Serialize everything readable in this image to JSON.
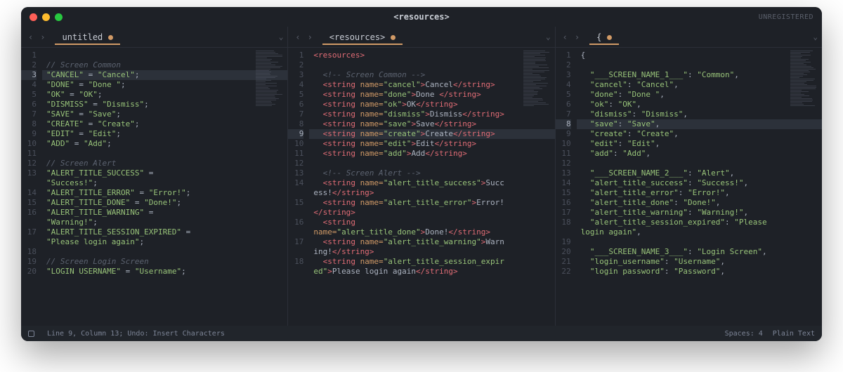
{
  "window": {
    "title": "<resources>",
    "unregistered": "UNREGISTERED"
  },
  "status": {
    "left": "Line 9, Column 13; Undo: Insert Characters",
    "spaces": "Spaces: 4",
    "syntax": "Plain Text"
  },
  "panes": [
    {
      "tab": "untitled",
      "current_line": 3,
      "lines": [
        {
          "n": 1,
          "h": ""
        },
        {
          "n": 2,
          "h": "<span class='c'>// Screen Common</span>"
        },
        {
          "n": 3,
          "h": "<span class='s'>\"CANCEL\"</span> = <span class='s'>\"Cancel\"</span>;"
        },
        {
          "n": 4,
          "h": "<span class='s'>\"DONE\"</span> = <span class='s'>\"Done \"</span>;"
        },
        {
          "n": 5,
          "h": "<span class='s'>\"OK\"</span> = <span class='s'>\"OK\"</span>;"
        },
        {
          "n": 6,
          "h": "<span class='s'>\"DISMISS\"</span> = <span class='s'>\"Dismiss\"</span>;"
        },
        {
          "n": 7,
          "h": "<span class='s'>\"SAVE\"</span> = <span class='s'>\"Save\"</span>;"
        },
        {
          "n": 8,
          "h": "<span class='s'>\"CREATE\"</span> = <span class='s'>\"Create\"</span>;"
        },
        {
          "n": 9,
          "h": "<span class='s'>\"EDIT\"</span> = <span class='s'>\"Edit\"</span>;"
        },
        {
          "n": 10,
          "h": "<span class='s'>\"ADD\"</span> = <span class='s'>\"Add\"</span>;"
        },
        {
          "n": 11,
          "h": ""
        },
        {
          "n": 12,
          "h": "<span class='c'>// Screen Alert</span>"
        },
        {
          "n": 13,
          "h": "<span class='s'>\"ALERT_TITLE_SUCCESS\"</span> = "
        },
        {
          "n": null,
          "h": "<span class='s'>\"Success!\"</span>;"
        },
        {
          "n": 14,
          "h": "<span class='s'>\"ALERT_TITLE_ERROR\"</span> = <span class='s'>\"Error!\"</span>;"
        },
        {
          "n": 15,
          "h": "<span class='s'>\"ALERT_TITLE_DONE\"</span> = <span class='s'>\"Done!\"</span>;"
        },
        {
          "n": 16,
          "h": "<span class='s'>\"ALERT_TITLE_WARNING\"</span> = "
        },
        {
          "n": null,
          "h": "<span class='s'>\"Warning!\"</span>;"
        },
        {
          "n": 17,
          "h": "<span class='s'>\"ALERT_TITLE_SESSION_EXPIRED\"</span> = "
        },
        {
          "n": null,
          "h": "<span class='s'>\"Please login again\"</span>;"
        },
        {
          "n": 18,
          "h": ""
        },
        {
          "n": 19,
          "h": "<span class='c'>// Screen Login Screen</span>"
        },
        {
          "n": 20,
          "h": "<span class='s'>\"LOGIN USERNAME\"</span> = <span class='s'>\"Username\"</span>;"
        }
      ]
    },
    {
      "tab": "<resources>",
      "current_line": 9,
      "lines": [
        {
          "n": 1,
          "h": "<span class='t'>&lt;resources&gt;</span>"
        },
        {
          "n": 2,
          "h": ""
        },
        {
          "n": 3,
          "h": "  <span class='c'>&lt;!-- Screen Common --&gt;</span>"
        },
        {
          "n": 4,
          "h": "  <span class='t'>&lt;string</span> <span class='a'>name=</span><span class='s'>\"cancel\"</span><span class='t'>&gt;</span>Cancel<span class='t'>&lt;/string&gt;</span>"
        },
        {
          "n": 5,
          "h": "  <span class='t'>&lt;string</span> <span class='a'>name=</span><span class='s'>\"done\"</span><span class='t'>&gt;</span>Done <span class='t'>&lt;/string&gt;</span>"
        },
        {
          "n": 6,
          "h": "  <span class='t'>&lt;string</span> <span class='a'>name=</span><span class='s'>\"ok\"</span><span class='t'>&gt;</span>OK<span class='t'>&lt;/string&gt;</span>"
        },
        {
          "n": 7,
          "h": "  <span class='t'>&lt;string</span> <span class='a'>name=</span><span class='s'>\"dismiss\"</span><span class='t'>&gt;</span>Dismiss<span class='t'>&lt;/string&gt;</span>"
        },
        {
          "n": 8,
          "h": "  <span class='t'>&lt;string</span> <span class='a'>name=</span><span class='s'>\"save\"</span><span class='t'>&gt;</span>Save<span class='t'>&lt;/string&gt;</span>"
        },
        {
          "n": 9,
          "h": "  <span class='t'>&lt;string</span> <span class='a'>name=</span><span class='s'>\"create\"</span><span class='t'>&gt;</span>Create<span class='t'>&lt;/string&gt;</span>"
        },
        {
          "n": 10,
          "h": "  <span class='t'>&lt;string</span> <span class='a'>name=</span><span class='s'>\"edit\"</span><span class='t'>&gt;</span>Edit<span class='t'>&lt;/string&gt;</span>"
        },
        {
          "n": 11,
          "h": "  <span class='t'>&lt;string</span> <span class='a'>name=</span><span class='s'>\"add\"</span><span class='t'>&gt;</span>Add<span class='t'>&lt;/string&gt;</span>"
        },
        {
          "n": 12,
          "h": ""
        },
        {
          "n": 13,
          "h": "  <span class='c'>&lt;!-- Screen Alert --&gt;</span>"
        },
        {
          "n": 14,
          "h": "  <span class='t'>&lt;string</span> <span class='a'>name=</span><span class='s'>\"alert_title_success\"</span><span class='t'>&gt;</span>Succ"
        },
        {
          "n": null,
          "h": "ess!<span class='t'>&lt;/string&gt;</span>"
        },
        {
          "n": 15,
          "h": "  <span class='t'>&lt;string</span> <span class='a'>name=</span><span class='s'>\"alert_title_error\"</span><span class='t'>&gt;</span>Error!"
        },
        {
          "n": null,
          "h": "<span class='t'>&lt;/string&gt;</span>"
        },
        {
          "n": 16,
          "h": "  <span class='t'>&lt;string</span> "
        },
        {
          "n": null,
          "h": "<span class='a'>name=</span><span class='s'>\"alert_title_done\"</span><span class='t'>&gt;</span>Done!<span class='t'>&lt;/string&gt;</span>"
        },
        {
          "n": 17,
          "h": "  <span class='t'>&lt;string</span> <span class='a'>name=</span><span class='s'>\"alert_title_warning\"</span><span class='t'>&gt;</span>Warn"
        },
        {
          "n": null,
          "h": "ing!<span class='t'>&lt;/string&gt;</span>"
        },
        {
          "n": 18,
          "h": "  <span class='t'>&lt;string</span> <span class='a'>name=</span><span class='s'>\"alert_title_session_expir</span>"
        },
        {
          "n": null,
          "h": "<span class='s'>ed\"</span><span class='t'>&gt;</span>Please login again<span class='t'>&lt;/string&gt;</span>"
        }
      ]
    },
    {
      "tab": "{",
      "current_line": 8,
      "lines": [
        {
          "n": 1,
          "h": "<span class='p'>{</span>"
        },
        {
          "n": 2,
          "h": ""
        },
        {
          "n": 3,
          "h": "  <span class='s'>\"___SCREEN_NAME_1___\"</span>: <span class='s'>\"Common\"</span>,"
        },
        {
          "n": 4,
          "h": "  <span class='s'>\"cancel\"</span>: <span class='s'>\"Cancel\"</span>,"
        },
        {
          "n": 5,
          "h": "  <span class='s'>\"done\"</span>: <span class='s'>\"Done \"</span>,"
        },
        {
          "n": 6,
          "h": "  <span class='s'>\"ok\"</span>: <span class='s'>\"OK\"</span>,"
        },
        {
          "n": 7,
          "h": "  <span class='s'>\"dismiss\"</span>: <span class='s'>\"Dismiss\"</span>,"
        },
        {
          "n": 8,
          "h": "  <span class='s'>\"save\"</span>: <span class='s'>\"Save\"</span>,"
        },
        {
          "n": 9,
          "h": "  <span class='s'>\"create\"</span>: <span class='s'>\"Create\"</span>,"
        },
        {
          "n": 10,
          "h": "  <span class='s'>\"edit\"</span>: <span class='s'>\"Edit\"</span>,"
        },
        {
          "n": 11,
          "h": "  <span class='s'>\"add\"</span>: <span class='s'>\"Add\"</span>,"
        },
        {
          "n": 12,
          "h": ""
        },
        {
          "n": 13,
          "h": "  <span class='s'>\"___SCREEN_NAME_2___\"</span>: <span class='s'>\"Alert\"</span>,"
        },
        {
          "n": 14,
          "h": "  <span class='s'>\"alert_title_success\"</span>: <span class='s'>\"Success!\"</span>,"
        },
        {
          "n": 15,
          "h": "  <span class='s'>\"alert_title_error\"</span>: <span class='s'>\"Error!\"</span>,"
        },
        {
          "n": 16,
          "h": "  <span class='s'>\"alert_title_done\"</span>: <span class='s'>\"Done!\"</span>,"
        },
        {
          "n": 17,
          "h": "  <span class='s'>\"alert_title_warning\"</span>: <span class='s'>\"Warning!\"</span>,"
        },
        {
          "n": 18,
          "h": "  <span class='s'>\"alert_title_session_expired\"</span>: <span class='s'>\"Please</span>"
        },
        {
          "n": null,
          "h": "<span class='s'>login again\"</span>,"
        },
        {
          "n": 19,
          "h": ""
        },
        {
          "n": 20,
          "h": "  <span class='s'>\"___SCREEN_NAME_3___\"</span>: <span class='s'>\"Login Screen\"</span>,"
        },
        {
          "n": 21,
          "h": "  <span class='s'>\"login_username\"</span>: <span class='s'>\"Username\"</span>,"
        },
        {
          "n": 22,
          "h": "  <span class='s'>\"login password\"</span>: <span class='s'>\"Password\"</span>,"
        }
      ]
    }
  ]
}
